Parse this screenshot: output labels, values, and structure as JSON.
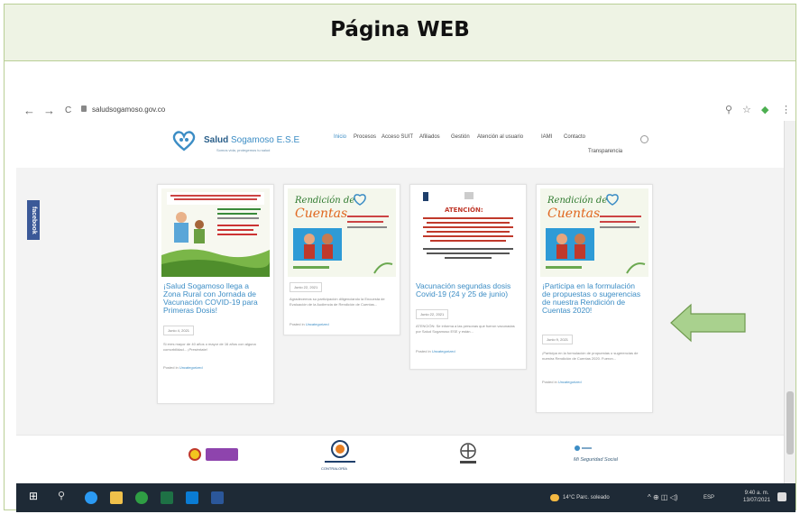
{
  "slide": {
    "title": "Página WEB"
  },
  "browser": {
    "url": "saludsogamoso.gov.co",
    "nav_back": "←",
    "nav_forward": "→",
    "nav_reload": "C"
  },
  "site": {
    "brand_main": "Salud",
    "brand_sub": "Sogamoso E.S.E",
    "tagline": "Somos vida, protegemos tu salud",
    "menu": [
      "Inicio",
      "Procesos",
      "Acceso SUIT",
      "Afiliados",
      "Gestión",
      "Atención al usuario",
      "IAMI",
      "Contacto"
    ],
    "transparency": "Transparencia",
    "facebook": "facebook"
  },
  "cards": [
    {
      "title": "¡Salud Sogamoso llega a Zona Rural con Jornada de Vacunación COVID-19 para Primeras Dosis!",
      "date": "Junio 4, 2021",
      "excerpt": "Si eres mayor de 40 años o mayor de 16 años con alguna comorbilidad... ¡Preséntate!",
      "posted_prefix": "Posted in",
      "category": "Uncategorized"
    },
    {
      "title": "",
      "date": "Junio 22, 2021",
      "excerpt": "Agradecemos su participación diligenciando la Encuesta de Evaluación de la Audiencia de Rendición de Cuentas...",
      "posted_prefix": "Posted in",
      "category": "Uncategorized"
    },
    {
      "title": "Vacunación segundas dosis Covid-19 (24 y 25 de junio)",
      "date": "Junio 22, 2021",
      "excerpt": "ATENCIÓN: Se informa a las personas que fueron vacunadas por Salud Sogamoso ESE y están...",
      "posted_prefix": "Posted in",
      "category": "Uncategorized"
    },
    {
      "title": "¡Participa en la formulación de propuestas o sugerencias de nuestra Rendición de Cuentas 2020!",
      "date": "Junio 9, 2021",
      "excerpt": "¡Participa en la formulación de propuestas o sugerencias de nuestra Rendición de Cuentas 2020. Fueron...",
      "posted_prefix": "Posted in",
      "category": "Uncategorized"
    }
  ],
  "card_art": {
    "rendicion_line1": "Rendición de",
    "rendicion_line2": "Cuentas",
    "atencion": "ATENCIÓN:"
  },
  "footer": {
    "logo_contraloria": "CONTRALORÍA",
    "logo_supersalud": "SUPERSALUD",
    "logo_minsalud": "MINSALUD",
    "logo_seguridad": "Mi Seguridad Social"
  },
  "taskbar": {
    "weather": "14°C Parc. soleado",
    "lang": "ESP",
    "time": "9:40 a. m.",
    "date": "13/07/2021"
  },
  "colors": {
    "accent": "#3c8dc5",
    "arrow": "#a9d18e",
    "taskbar": "#1e2a36"
  }
}
